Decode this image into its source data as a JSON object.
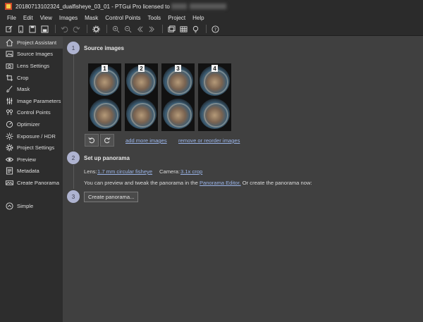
{
  "window": {
    "title_prefix": "20180713102324_dualfisheye_03_01 - PTGui Pro licensed to",
    "title_suffix": ""
  },
  "menu": [
    "File",
    "Edit",
    "View",
    "Images",
    "Mask",
    "Control Points",
    "Tools",
    "Project",
    "Help"
  ],
  "toolbar_icons": [
    "new-project-icon",
    "open-icon",
    "save-as-icon",
    "save-icon",
    "undo-icon",
    "redo-icon",
    "settings-icon",
    "zoom-in-icon",
    "zoom-out-icon",
    "previous-icon",
    "next-icon",
    "panorama-editor-icon",
    "table-icon",
    "bulb-icon",
    "help-icon"
  ],
  "sidebar": {
    "items": [
      {
        "label": "Project Assistant",
        "icon": "home-icon",
        "active": true
      },
      {
        "label": "Source Images",
        "icon": "image-icon",
        "active": false
      },
      {
        "label": "Lens Settings",
        "icon": "camera-icon",
        "active": false
      },
      {
        "label": "Crop",
        "icon": "crop-icon",
        "active": false
      },
      {
        "label": "Mask",
        "icon": "brush-icon",
        "active": false
      },
      {
        "label": "Image Parameters",
        "icon": "sliders-icon",
        "active": false
      },
      {
        "label": "Control Points",
        "icon": "control-points-icon",
        "active": false
      },
      {
        "label": "Optimizer",
        "icon": "optimizer-icon",
        "active": false
      },
      {
        "label": "Exposure / HDR",
        "icon": "sun-icon",
        "active": false
      },
      {
        "label": "Project Settings",
        "icon": "gear-icon",
        "active": false
      },
      {
        "label": "Preview",
        "icon": "eye-icon",
        "active": false
      },
      {
        "label": "Metadata",
        "icon": "metadata-icon",
        "active": false
      },
      {
        "label": "Create Panorama",
        "icon": "panorama-icon",
        "active": false
      }
    ],
    "mode_label": "Simple"
  },
  "steps": {
    "step1": {
      "number": "1",
      "title": "Source images"
    },
    "step2": {
      "number": "2",
      "title": "Set up panorama"
    },
    "step3": {
      "number": "3"
    }
  },
  "images": {
    "numbers": [
      "1",
      "2",
      "3",
      "4"
    ],
    "add_more_label": "add more images",
    "remove_reorder_label": "remove or reorder images"
  },
  "panorama": {
    "lens_label": "Lens:",
    "lens_value": "1.7 mm circular fisheye",
    "camera_label": "Camera:",
    "camera_value": "3.1x crop",
    "preview_text_before": "You can preview and tweak the panorama in the",
    "editor_link": "Panorama Editor.",
    "preview_text_after": "Or create the panorama now:",
    "create_button": "Create panorama..."
  },
  "colors": {
    "step_circle": "#aeb3d0",
    "link": "#9ab4e8",
    "sidebar_bg": "#2d2d2d",
    "main_bg": "#404040"
  }
}
